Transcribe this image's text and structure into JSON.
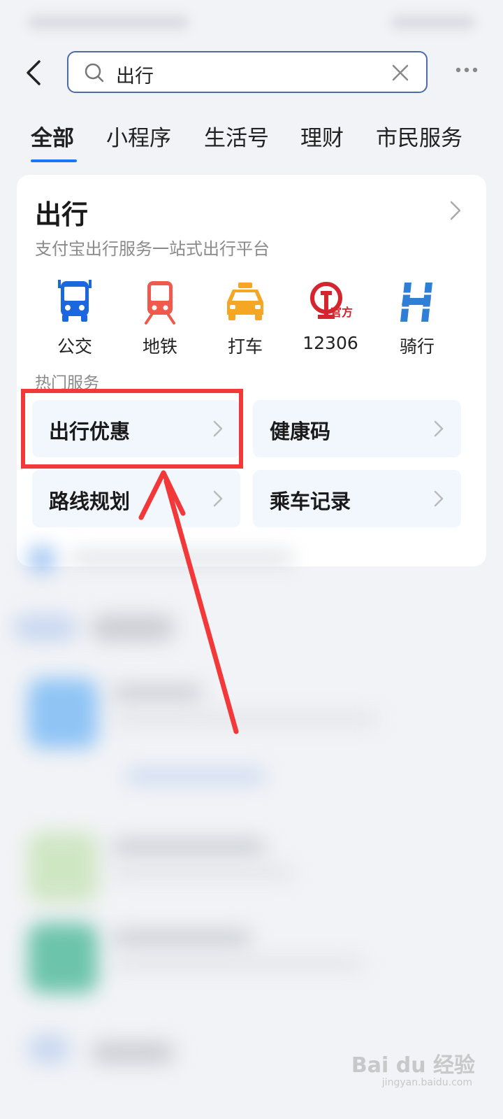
{
  "search": {
    "query": "出行"
  },
  "tabs": [
    "全部",
    "小程序",
    "生活号",
    "理财",
    "市民服务"
  ],
  "card": {
    "title": "出行",
    "subtitle": "支付宝出行服务一站式出行平台",
    "services": [
      {
        "label": "公交",
        "icon": "bus-icon"
      },
      {
        "label": "地铁",
        "icon": "metro-icon"
      },
      {
        "label": "打车",
        "icon": "taxi-icon"
      },
      {
        "label": "12306",
        "icon": "railway-12306-icon",
        "badge": "官方"
      },
      {
        "label": "骑行",
        "icon": "bike-icon"
      }
    ],
    "hot_title": "热门服务",
    "hot_items": [
      "出行优惠",
      "健康码",
      "路线规划",
      "乘车记录"
    ]
  },
  "watermark": {
    "brand": "Bai du 经验",
    "url": "jingyan.baidu.com"
  },
  "colors": {
    "accent": "#1677ff",
    "highlight": "#f23838"
  }
}
